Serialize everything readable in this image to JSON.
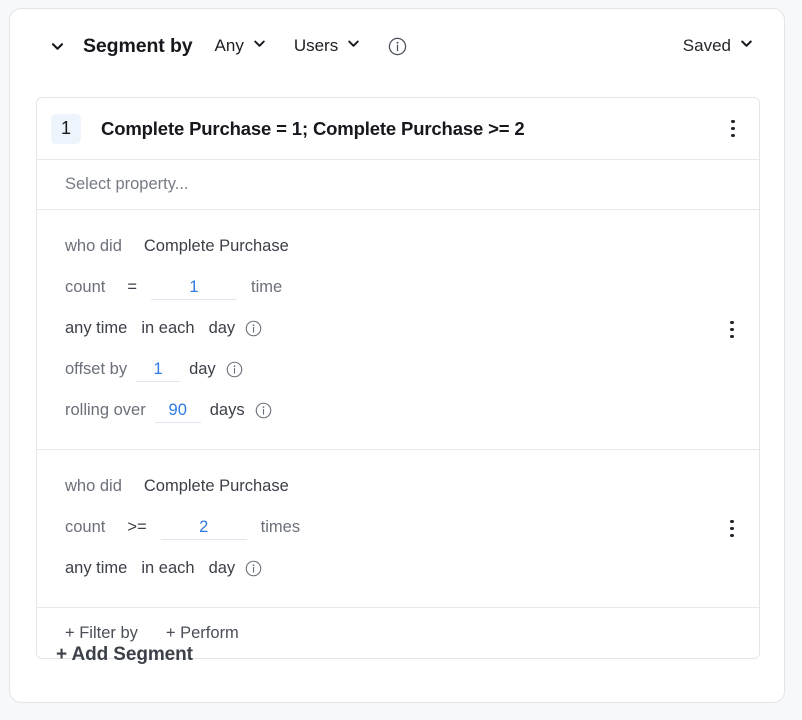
{
  "toolbar": {
    "collapse_icon": "chevron-down-icon",
    "title": "Segment by",
    "match_dropdown": {
      "value": "Any",
      "icon": "chevron-down-icon"
    },
    "entity_dropdown": {
      "value": "Users",
      "icon": "chevron-down-icon"
    },
    "info_icon": "info-circle-icon",
    "saved_dropdown": {
      "value": "Saved",
      "icon": "chevron-down-icon"
    }
  },
  "rule": {
    "badge": "1",
    "title": "Complete Purchase = 1; Complete Purchase >= 2",
    "menu_icon": "kebab-menu-icon",
    "select_property_placeholder": "Select property...",
    "conditions": [
      {
        "who_did_label": "who did",
        "event": "Complete Purchase",
        "count_label": "count",
        "operator": "=",
        "count_value": "1",
        "count_unit": "time",
        "timeframe": "any time",
        "bucket_label": "in each",
        "bucket_unit": "day",
        "bucket_info_icon": "info-circle-icon",
        "offset_label": "offset by",
        "offset_value": "1",
        "offset_unit": "day",
        "offset_info_icon": "info-circle-icon",
        "rolling_label": "rolling over",
        "rolling_value": "90",
        "rolling_unit": "days",
        "rolling_info_icon": "info-circle-icon",
        "menu_icon": "kebab-menu-icon"
      },
      {
        "who_did_label": "who did",
        "event": "Complete Purchase",
        "count_label": "count",
        "operator": ">=",
        "count_value": "2",
        "count_unit": "times",
        "timeframe": "any time",
        "bucket_label": "in each",
        "bucket_unit": "day",
        "bucket_info_icon": "info-circle-icon",
        "menu_icon": "kebab-menu-icon"
      }
    ],
    "footer": {
      "filter_by": "+ Filter by",
      "perform": "+ Perform"
    }
  },
  "add_segment": "+ Add Segment",
  "colors": {
    "accent_blue": "#2f7ae5",
    "badge_bg": "#eef4fb",
    "text_dark": "#16181d",
    "text_muted": "#6b707a",
    "border": "#e3e5e8"
  }
}
